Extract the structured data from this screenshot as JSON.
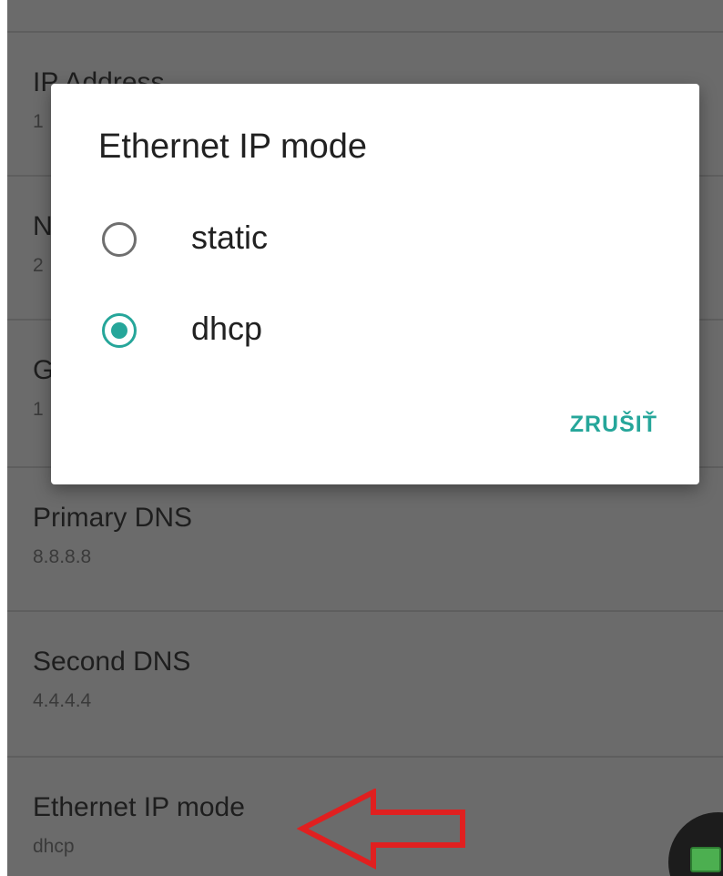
{
  "settings": {
    "items": [
      {
        "title": "IP Address",
        "summary": "1"
      },
      {
        "title": "N",
        "summary": "2"
      },
      {
        "title": "G",
        "summary": "1"
      },
      {
        "title": "Primary DNS",
        "summary": "8.8.8.8"
      },
      {
        "title": "Second DNS",
        "summary": "4.4.4.4"
      },
      {
        "title": "Ethernet IP mode",
        "summary": "dhcp"
      }
    ]
  },
  "dialog": {
    "title": "Ethernet IP mode",
    "options": [
      {
        "label": "static",
        "selected": false
      },
      {
        "label": "dhcp",
        "selected": true
      }
    ],
    "cancel_label": "ZRUŠIŤ"
  },
  "colors": {
    "accent": "#26a69a",
    "annotation_arrow": "#e02020",
    "scrim": "#6b6b6b"
  },
  "icons": {
    "fab": "network-icon",
    "annotation": "arrow-left-icon"
  }
}
